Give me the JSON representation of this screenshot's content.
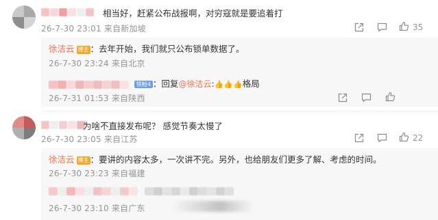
{
  "comments": [
    {
      "text": "相当好，赶紧公布战报啊，对穷寇就是要追着打",
      "meta": "26-7-30 23:01 来自新加坡",
      "likes": "35",
      "replies": [
        {
          "name": "徐洁云",
          "badge": "博主",
          "text": "：去年开始，我们就只公布锁单数据了。",
          "meta": "26-7-30 23:24 来自北京"
        },
        {
          "fan_badge": "铁粉4",
          "reply_prefix": "：回复",
          "reply_to": "@徐洁云",
          "reply_suffix": ":",
          "emoji_alt": "👍👍👍",
          "text": "格局",
          "meta": "26-7-31 01:53 来自陕西"
        }
      ]
    },
    {
      "text": "为啥不直接发布呢？ 感觉节奏太慢了",
      "meta": "26-7-30 23:05 来自江苏",
      "likes": "22",
      "replies": [
        {
          "name": "徐洁云",
          "badge": "博主",
          "text": "：要讲的内容太多，一次讲不完。另外，也给朋友们更多了解、考虑的时间。",
          "meta": "26-7-30 23:23 来自福建"
        },
        {
          "meta": "26-7-30 23:10 来自广东"
        }
      ]
    }
  ],
  "colors": {
    "accent": "#eb7350",
    "meta": "#939393",
    "badge": "#f5a623",
    "fan_badge": "#6ba0e6",
    "sub_bg": "#f7f7f7"
  },
  "icons": [
    "share-icon",
    "comment-icon",
    "like-icon"
  ]
}
